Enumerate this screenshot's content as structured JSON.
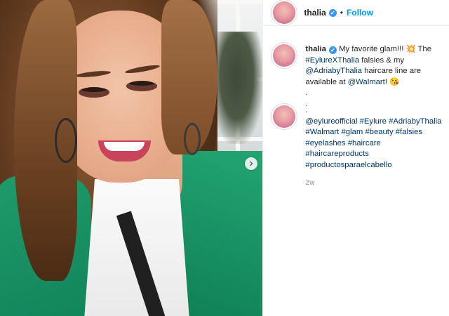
{
  "post": {
    "username": "thalia",
    "follow_label": "Follow",
    "dot": "•",
    "verified_glyph": "✔",
    "caption": {
      "text_1": "My favorite glam!!! ",
      "emoji_1": "💥",
      "text_2": " The ",
      "tag_eylurexthalia": "#EylureXThalia",
      "text_3": " falsies & my ",
      "mention_adriaby": "@AdriabyThalia",
      "text_4": " haircare line are available at ",
      "mention_walmart": "@Walmart",
      "text_5": "! ",
      "emoji_2": "😘",
      "dots": [
        ".",
        ".",
        "."
      ]
    },
    "comment": {
      "items": [
        "@eylureofficial",
        "#Eylure",
        "#AdriabyThalia",
        "#Walmart",
        "#glam",
        "#beauty",
        "#falsies",
        "#eyelashes",
        "#haircare",
        "#haircareproducts",
        "#productosparaelcabello"
      ],
      "timestamp": "2w"
    }
  },
  "icons": {
    "carousel": "chevron-right-icon",
    "verified": "verified-badge-icon"
  },
  "colors": {
    "link": "#00376b",
    "follow": "#0095f6",
    "verified": "#3897f0",
    "jacket": "#1a9466"
  }
}
